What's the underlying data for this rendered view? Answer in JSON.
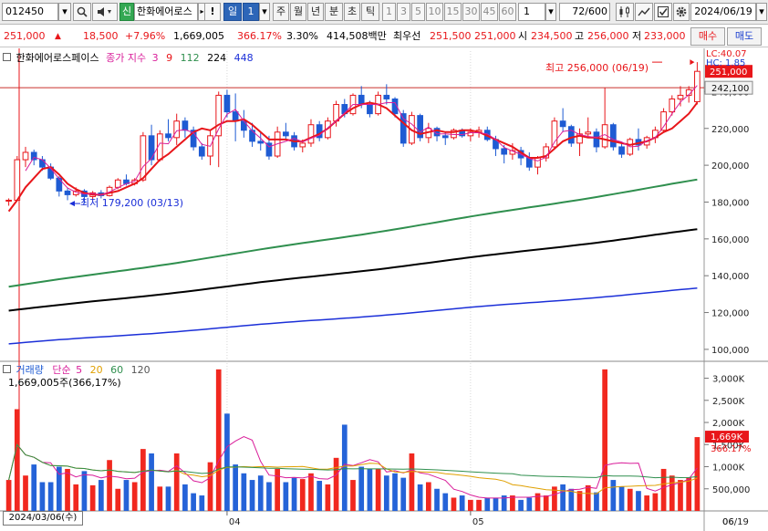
{
  "toolbar": {
    "code": "012450",
    "credit_badge": "신",
    "stock_name": "한화에어로스",
    "warn": "!",
    "period": "일",
    "period_n": "1",
    "periods": [
      "주",
      "월",
      "년",
      "분",
      "초",
      "틱"
    ],
    "minute_steps": [
      "1",
      "3",
      "5",
      "10",
      "15",
      "30",
      "45",
      "60"
    ],
    "interval": "1",
    "count": "72",
    "count_total": "/600",
    "date": "2024/06/19"
  },
  "quote": {
    "price": "251,000",
    "arrow": "▲",
    "change": "18,500",
    "change_pct": "+7.96%",
    "volume": "1,669,005",
    "volume_ratio": "366.17%",
    "turnover": "3.30%",
    "amount": "414,508백만",
    "best_bid_label": "최우선",
    "best_ask": "251,500",
    "best_bid": "251,000",
    "open_label": "시",
    "open": "234,500",
    "high_label": "고",
    "high": "256,000",
    "low_label": "저",
    "low": "233,000",
    "buy_button": "매수",
    "sell_button": "매도"
  },
  "colors": {
    "up": "#e8161a",
    "down": "#1e5bd3",
    "ma5": "#e8161a",
    "ma20": "#d91e9a",
    "ma60": "#2f8f4e",
    "ma120": "#000000",
    "ma224": "#1b2fd8"
  },
  "chart_data": {
    "type": "candlestick",
    "price_panel": {
      "title": "한화에어로스페이스",
      "legend_label": "종가 지수",
      "ma_periods": [
        "3",
        "9",
        "112",
        "224",
        "448"
      ],
      "lc_label": "LC:40.07",
      "hc_label": "HC: 1.85",
      "y_ticks": [
        "240,000",
        "220,000",
        "200,000",
        "180,000",
        "160,000",
        "140,000",
        "120,000",
        "100,000"
      ],
      "ylim": [
        95000,
        262000
      ],
      "current_price_label": "251,000",
      "ref_price_label": "242,100",
      "high_annotation": "최고 256,000 (06/19)",
      "low_annotation": "최저 179,200 (03/13)",
      "high_value": 256000,
      "low_value": 179200,
      "ref_value": 242100,
      "candles": [
        [
          180800,
          182000,
          178000,
          181000
        ],
        [
          181000,
          205000,
          180500,
          203000
        ],
        [
          203000,
          210000,
          199000,
          207000
        ],
        [
          207000,
          208500,
          200000,
          203000
        ],
        [
          203000,
          205000,
          197000,
          199000
        ],
        [
          199000,
          201000,
          192000,
          193000
        ],
        [
          193000,
          194000,
          183000,
          186000
        ],
        [
          186000,
          187500,
          181000,
          184000
        ],
        [
          184000,
          188000,
          183000,
          186000
        ],
        [
          186000,
          187000,
          179200,
          183000
        ],
        [
          183000,
          186000,
          181000,
          185000
        ],
        [
          185000,
          186500,
          182000,
          183500
        ],
        [
          183500,
          189000,
          183000,
          188000
        ],
        [
          188000,
          193000,
          187000,
          192000
        ],
        [
          192000,
          195000,
          189000,
          190000
        ],
        [
          190000,
          193000,
          189000,
          192000
        ],
        [
          192000,
          218000,
          191000,
          216000
        ],
        [
          216000,
          222000,
          200000,
          203000
        ],
        [
          203000,
          219000,
          202000,
          217000
        ],
        [
          217000,
          225000,
          213000,
          215000
        ],
        [
          215000,
          228000,
          211000,
          224000
        ],
        [
          224000,
          226000,
          215000,
          219000
        ],
        [
          219000,
          221000,
          208000,
          210000
        ],
        [
          210000,
          212000,
          203000,
          205000
        ],
        [
          205000,
          219000,
          200000,
          216000
        ],
        [
          216000,
          240000,
          199000,
          238000
        ],
        [
          238000,
          241000,
          226000,
          229000
        ],
        [
          229000,
          239000,
          213000,
          224000
        ],
        [
          224000,
          230000,
          215000,
          219000
        ],
        [
          219000,
          223000,
          210000,
          213000
        ],
        [
          213000,
          218000,
          208000,
          212000
        ],
        [
          212000,
          216000,
          203000,
          205000
        ],
        [
          205000,
          221000,
          204000,
          218000
        ],
        [
          218000,
          223000,
          214000,
          216000
        ],
        [
          216000,
          218000,
          208000,
          210000
        ],
        [
          210000,
          214000,
          207000,
          212000
        ],
        [
          212000,
          225000,
          210000,
          222000
        ],
        [
          222000,
          224000,
          213000,
          215000
        ],
        [
          215000,
          226000,
          214000,
          224000
        ],
        [
          224000,
          235000,
          221000,
          233000
        ],
        [
          233000,
          236000,
          226000,
          228000
        ],
        [
          228000,
          239000,
          227000,
          238000
        ],
        [
          238000,
          243000,
          231000,
          233000
        ],
        [
          233000,
          235000,
          226000,
          228000
        ],
        [
          228000,
          240000,
          227000,
          238000
        ],
        [
          238000,
          244000,
          233000,
          236000
        ],
        [
          236000,
          237000,
          226000,
          228000
        ],
        [
          228000,
          230000,
          210000,
          212000
        ],
        [
          212000,
          229000,
          211000,
          227000
        ],
        [
          227000,
          228000,
          213000,
          215000
        ],
        [
          215000,
          223000,
          212000,
          220000
        ],
        [
          220000,
          221000,
          213000,
          216000
        ],
        [
          216000,
          218000,
          211000,
          215000
        ],
        [
          215000,
          220000,
          214000,
          219000
        ],
        [
          219000,
          220000,
          215000,
          216000
        ],
        [
          216000,
          220000,
          213000,
          218000
        ],
        [
          218000,
          221000,
          215000,
          219000
        ],
        [
          219000,
          221000,
          213000,
          214000
        ],
        [
          214000,
          216000,
          205000,
          209000
        ],
        [
          209000,
          211000,
          201000,
          206000
        ],
        [
          206000,
          212000,
          203000,
          208000
        ],
        [
          208000,
          210000,
          200000,
          204000
        ],
        [
          204000,
          207000,
          197000,
          199000
        ],
        [
          199000,
          205000,
          195000,
          204000
        ],
        [
          204000,
          212000,
          202000,
          210000
        ],
        [
          210000,
          226000,
          209000,
          224000
        ],
        [
          224000,
          231000,
          218000,
          221000
        ],
        [
          221000,
          222000,
          210000,
          212000
        ],
        [
          212000,
          220000,
          205000,
          217000
        ],
        [
          217000,
          226000,
          215000,
          218000
        ],
        [
          218000,
          220000,
          207000,
          210000
        ],
        [
          210000,
          242000,
          209000,
          222000
        ],
        [
          222000,
          223000,
          208000,
          210000
        ],
        [
          210000,
          212000,
          204000,
          206000
        ],
        [
          206000,
          215000,
          205000,
          214000
        ],
        [
          214000,
          220000,
          208000,
          211000
        ],
        [
          211000,
          216000,
          209000,
          215000
        ],
        [
          215000,
          221000,
          212000,
          219000
        ],
        [
          219000,
          231000,
          218000,
          229000
        ],
        [
          229000,
          238000,
          227000,
          236000
        ],
        [
          236000,
          243000,
          232000,
          238000
        ],
        [
          238000,
          243000,
          234000,
          241000
        ],
        [
          234500,
          256000,
          233000,
          251000
        ]
      ],
      "ma5": [
        175000,
        181000,
        188000,
        193000,
        198000,
        199000,
        195000,
        190000,
        187000,
        185000,
        184000,
        184000,
        185000,
        186000,
        188000,
        190000,
        193000,
        198000,
        203000,
        206000,
        210000,
        214000,
        218000,
        220000,
        219000,
        222000,
        224000,
        224000,
        225000,
        222000,
        218000,
        214000,
        214000,
        214000,
        213000,
        213000,
        215000,
        217000,
        220000,
        224000,
        228000,
        231000,
        233000,
        234000,
        233000,
        231000,
        227000,
        223000,
        219000,
        217000,
        218000,
        219000,
        218000,
        218000,
        219000,
        219000,
        218000,
        216000,
        214000,
        212000,
        210000,
        207000,
        204000,
        204000,
        205000,
        209000,
        213000,
        215000,
        216000,
        215000,
        215000,
        214000,
        213000,
        212000,
        211000,
        212000,
        213000,
        215000,
        218000,
        220000,
        224000,
        228000,
        234000
      ],
      "ma20": [
        null,
        null,
        null,
        null,
        null,
        null,
        null,
        null,
        null,
        null,
        null,
        null,
        null,
        null,
        null,
        null,
        null,
        null,
        null,
        null,
        null,
        null,
        null,
        null,
        null,
        null,
        null,
        null,
        null,
        null,
        null,
        null,
        null,
        null,
        null,
        null,
        null,
        null,
        null,
        null,
        null,
        null,
        null,
        null,
        null,
        null,
        null,
        null,
        null,
        null,
        null,
        null,
        null,
        null,
        null,
        null,
        null,
        null,
        null,
        null,
        null,
        null,
        null,
        null,
        null,
        null,
        null,
        null,
        null,
        null,
        null,
        null,
        null,
        null,
        null,
        null,
        null,
        null,
        null,
        null,
        null,
        null,
        null
      ],
      "ma60_ends": [
        134000,
        192000
      ],
      "ma120_ends": [
        121000,
        165000
      ],
      "ma224_ends": [
        103000,
        133000
      ]
    },
    "volume_panel": {
      "legend_label": "거래량",
      "ma_label": "단순",
      "ma_periods": [
        "5",
        "20",
        "60",
        "120"
      ],
      "value_label": "1,669,005주(366,17%)",
      "y_ticks": [
        "3,000K",
        "2,500K",
        "2,000K",
        "1,500K",
        "1,000K",
        "500,000"
      ],
      "ylim": [
        0,
        3300000
      ],
      "current_label": "1,669K",
      "current_pct_label": "366.17%",
      "volumes": [
        700000,
        2300000,
        800000,
        1050000,
        650000,
        650000,
        1000000,
        950000,
        600000,
        900000,
        580000,
        700000,
        1150000,
        500000,
        700000,
        650000,
        1400000,
        1300000,
        550000,
        550000,
        1300000,
        600000,
        400000,
        350000,
        1100000,
        3200000,
        2200000,
        1050000,
        850000,
        700000,
        800000,
        650000,
        950000,
        650000,
        750000,
        720000,
        850000,
        680000,
        600000,
        1200000,
        1950000,
        700000,
        1000000,
        950000,
        950000,
        800000,
        850000,
        750000,
        1300000,
        600000,
        650000,
        500000,
        400000,
        300000,
        350000,
        250000,
        250000,
        300000,
        300000,
        350000,
        350000,
        250000,
        300000,
        400000,
        350000,
        550000,
        600000,
        500000,
        450000,
        580000,
        420000,
        3200000,
        700000,
        550000,
        500000,
        450000,
        350000,
        400000,
        950000,
        800000,
        700000,
        750000,
        1669005
      ],
      "vol_up": [
        true,
        true,
        true,
        false,
        false,
        false,
        false,
        true,
        true,
        false,
        true,
        false,
        true,
        true,
        false,
        true,
        true,
        false,
        true,
        false,
        true,
        false,
        false,
        false,
        true,
        true,
        false,
        false,
        false,
        false,
        false,
        false,
        true,
        false,
        false,
        true,
        true,
        false,
        true,
        true,
        false,
        true,
        false,
        false,
        true,
        false,
        false,
        false,
        true,
        false,
        true,
        false,
        false,
        true,
        false,
        true,
        true,
        false,
        false,
        false,
        true,
        false,
        false,
        true,
        true,
        true,
        false,
        false,
        true,
        true,
        false,
        true,
        false,
        false,
        true,
        false,
        true,
        true,
        true,
        true,
        true,
        true,
        true
      ]
    },
    "x_ticks": [
      {
        "index": 26,
        "label": "04"
      },
      {
        "index": 55,
        "label": "05"
      },
      {
        "index": 84,
        "label": "06"
      },
      {
        "index": 110,
        "label": "06/19"
      }
    ],
    "crosshair_date": "2024/03/06(수)"
  }
}
